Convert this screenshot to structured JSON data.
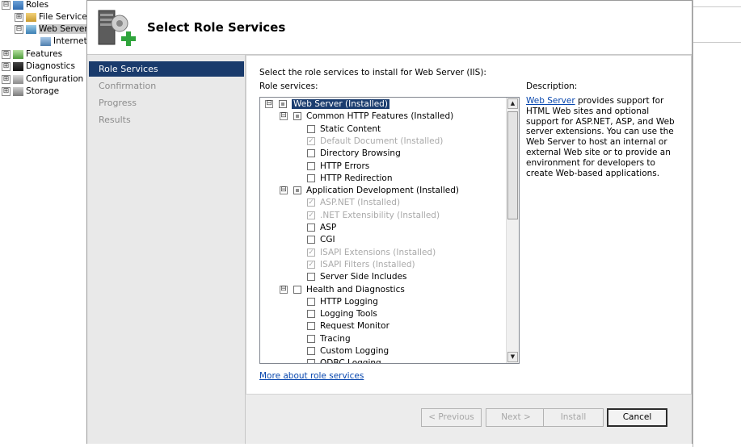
{
  "tree": {
    "items": [
      {
        "label": "Roles",
        "expander": "⊟"
      },
      {
        "label": "File Services",
        "expander": "⊞"
      },
      {
        "label": "Web Server",
        "expander": "⊟"
      },
      {
        "label": "Internet",
        "expander": ""
      },
      {
        "label": "Features",
        "expander": "⊞"
      },
      {
        "label": "Diagnostics",
        "expander": "⊞"
      },
      {
        "label": "Configuration",
        "expander": "⊞"
      },
      {
        "label": "Storage",
        "expander": "⊞"
      }
    ]
  },
  "dialog": {
    "title": "Select Role Services",
    "nav": [
      {
        "label": "Role Services",
        "active": true
      },
      {
        "label": "Confirmation",
        "active": false
      },
      {
        "label": "Progress",
        "active": false
      },
      {
        "label": "Results",
        "active": false
      }
    ],
    "instruction": "Select the role services to install for Web Server (IIS):",
    "role_services_label": "Role services:",
    "description_label": "Description:",
    "description_link": "Web Server",
    "description_text": " provides support for HTML Web sites and optional support for ASP.NET, ASP, and Web server extensions. You can use the Web Server to host an internal or external Web site or to provide an environment for developers to create Web-based applications.",
    "more_link": "More about role services",
    "role_services": [
      {
        "label": "Web Server  (Installed)",
        "level": 0,
        "state": "partial",
        "expander": "⊟",
        "disabled": false,
        "selected": true
      },
      {
        "label": "Common HTTP Features  (Installed)",
        "level": 1,
        "state": "partial",
        "expander": "⊟",
        "disabled": false,
        "selected": false
      },
      {
        "label": "Static Content",
        "level": 2,
        "state": "unchecked",
        "expander": "",
        "disabled": false,
        "selected": false
      },
      {
        "label": "Default Document  (Installed)",
        "level": 2,
        "state": "checked",
        "expander": "",
        "disabled": true,
        "selected": false
      },
      {
        "label": "Directory Browsing",
        "level": 2,
        "state": "unchecked",
        "expander": "",
        "disabled": false,
        "selected": false
      },
      {
        "label": "HTTP Errors",
        "level": 2,
        "state": "unchecked",
        "expander": "",
        "disabled": false,
        "selected": false
      },
      {
        "label": "HTTP Redirection",
        "level": 2,
        "state": "unchecked",
        "expander": "",
        "disabled": false,
        "selected": false
      },
      {
        "label": "Application Development  (Installed)",
        "level": 1,
        "state": "partial",
        "expander": "⊟",
        "disabled": false,
        "selected": false
      },
      {
        "label": "ASP.NET  (Installed)",
        "level": 2,
        "state": "checked",
        "expander": "",
        "disabled": true,
        "selected": false
      },
      {
        "label": ".NET Extensibility  (Installed)",
        "level": 2,
        "state": "checked",
        "expander": "",
        "disabled": true,
        "selected": false
      },
      {
        "label": "ASP",
        "level": 2,
        "state": "unchecked",
        "expander": "",
        "disabled": false,
        "selected": false
      },
      {
        "label": "CGI",
        "level": 2,
        "state": "unchecked",
        "expander": "",
        "disabled": false,
        "selected": false
      },
      {
        "label": "ISAPI Extensions  (Installed)",
        "level": 2,
        "state": "checked",
        "expander": "",
        "disabled": true,
        "selected": false
      },
      {
        "label": "ISAPI Filters  (Installed)",
        "level": 2,
        "state": "checked",
        "expander": "",
        "disabled": true,
        "selected": false
      },
      {
        "label": "Server Side Includes",
        "level": 2,
        "state": "unchecked",
        "expander": "",
        "disabled": false,
        "selected": false
      },
      {
        "label": "Health and Diagnostics",
        "level": 1,
        "state": "unchecked",
        "expander": "⊟",
        "disabled": false,
        "selected": false
      },
      {
        "label": "HTTP Logging",
        "level": 2,
        "state": "unchecked",
        "expander": "",
        "disabled": false,
        "selected": false
      },
      {
        "label": "Logging Tools",
        "level": 2,
        "state": "unchecked",
        "expander": "",
        "disabled": false,
        "selected": false
      },
      {
        "label": "Request Monitor",
        "level": 2,
        "state": "unchecked",
        "expander": "",
        "disabled": false,
        "selected": false
      },
      {
        "label": "Tracing",
        "level": 2,
        "state": "unchecked",
        "expander": "",
        "disabled": false,
        "selected": false
      },
      {
        "label": "Custom Logging",
        "level": 2,
        "state": "unchecked",
        "expander": "",
        "disabled": false,
        "selected": false
      },
      {
        "label": "ODBC Logging",
        "level": 2,
        "state": "unchecked",
        "expander": "",
        "disabled": false,
        "selected": false
      }
    ],
    "buttons": {
      "previous": "< Previous",
      "next": "Next >",
      "install": "Install",
      "cancel": "Cancel"
    }
  },
  "colors": {
    "nav_active": "#1a3b6c",
    "link": "#0645ad",
    "selection": "#1b3d6f"
  }
}
